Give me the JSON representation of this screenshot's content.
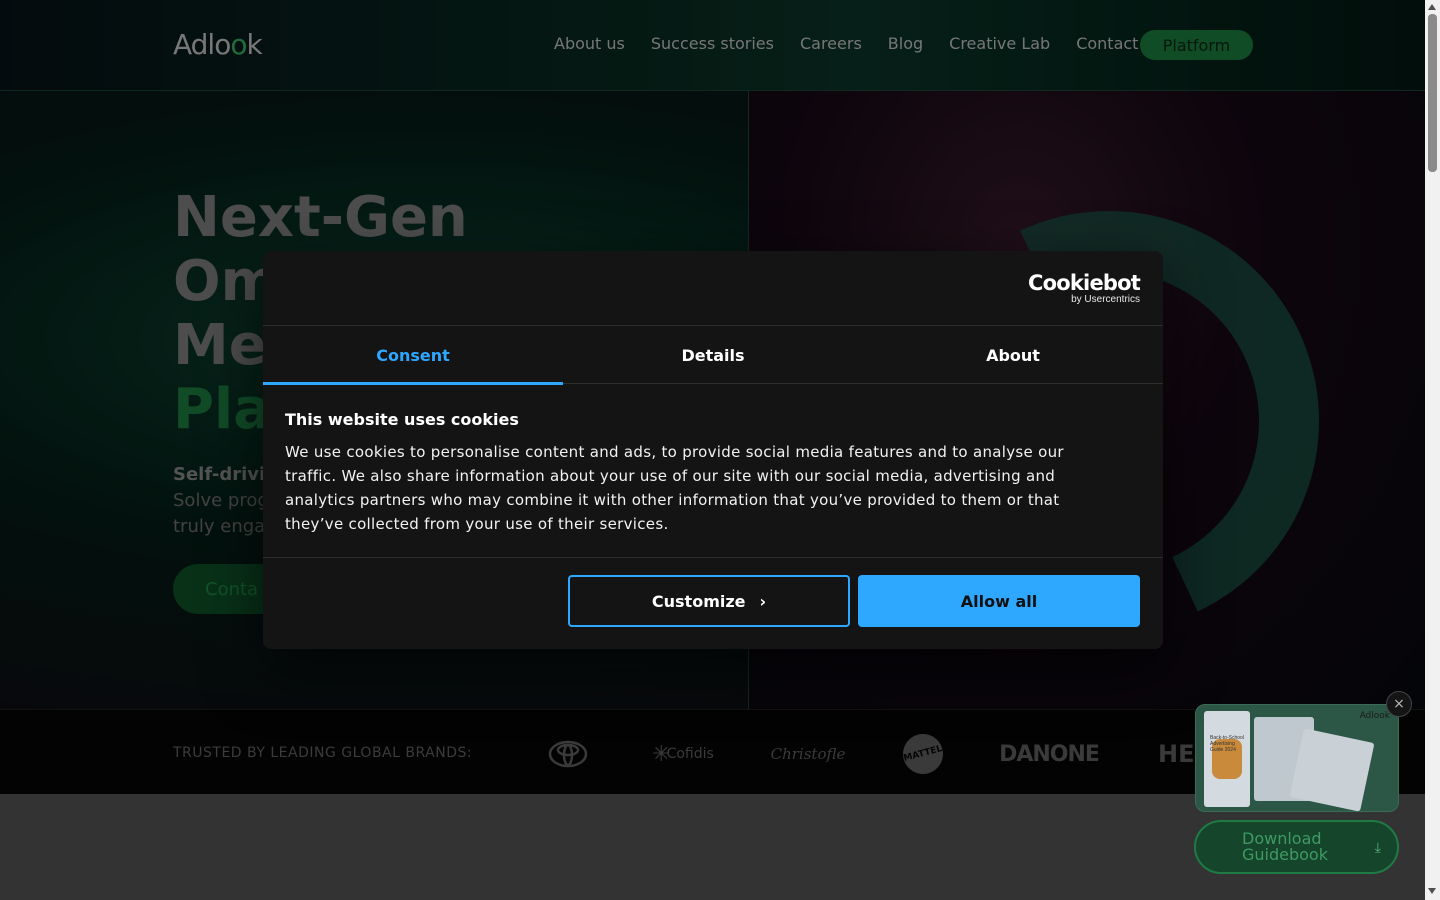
{
  "header": {
    "logo_text": "Adlo",
    "logo_accent": "o",
    "logo_tail": "k",
    "nav": [
      "About us",
      "Success stories",
      "Careers",
      "Blog",
      "Creative Lab",
      "Contact"
    ],
    "platform_label": "Platform"
  },
  "hero": {
    "title_line1": "Next-Gen",
    "title_line2": "Om",
    "title_line3": "Me",
    "title_line4": "Pla",
    "sub_bold": "Self-drivin",
    "sub_line2": "Solve prog",
    "sub_line3": "truly engag",
    "cta_label": "Conta"
  },
  "brands": {
    "label": "TRUSTED BY LEADING GLOBAL BRANDS:",
    "items": [
      "toyota-logo",
      "Cofidis",
      "Christofle",
      "MATTEL",
      "DANONE",
      "HEI"
    ]
  },
  "cookie_dialog": {
    "provider_name": "Cookiebot",
    "provider_by": "by Usercentrics",
    "tabs": [
      {
        "label": "Consent",
        "active": true
      },
      {
        "label": "Details",
        "active": false
      },
      {
        "label": "About",
        "active": false
      }
    ],
    "title": "This website uses cookies",
    "body_line1": "We use cookies to personalise content and ads, to provide social media features and to analyse our",
    "body_line2": "traffic. We also share information about your use of our site with our social media, advertising and",
    "body_line3": "analytics partners who may combine it with other information that you’ve provided to them or that",
    "body_line4": "they’ve collected from your use of their services.",
    "customize_label": "Customize",
    "allow_label": "Allow all",
    "accent_color": "#2ea7ff"
  },
  "guidebook": {
    "brand": "Adlook",
    "cover_text": "Back-to-School Advertising Guide 2024",
    "button_line1": "Download",
    "button_line2": "Guidebook",
    "close_symbol": "×"
  }
}
